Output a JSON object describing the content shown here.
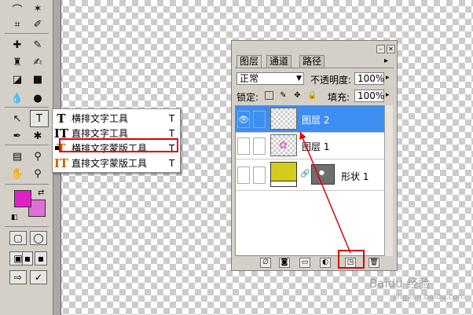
{
  "toolbox": {
    "tools": [
      "lasso-icon",
      "magic-wand-icon",
      "crop-icon",
      "slice-icon",
      "healing-brush-icon",
      "brush-icon",
      "clone-stamp-icon",
      "history-brush-icon",
      "eraser-icon",
      "gradient-icon",
      "blur-icon",
      "dodge-icon",
      "path-select-icon",
      "type-tool-icon",
      "pen-icon",
      "custom-shape-icon",
      "notes-icon",
      "eyedropper-icon",
      "hand-icon",
      "zoom-icon"
    ],
    "foreground_color": "#e020c8",
    "background_color": "#e070d8"
  },
  "flyout": {
    "items": [
      {
        "label": "横排文字工具",
        "key": "T",
        "icon": "T"
      },
      {
        "label": "直排文字工具",
        "key": "T",
        "icon": "IT"
      },
      {
        "label": "横排文字蒙版工具",
        "key": "T",
        "icon": "T"
      },
      {
        "label": "直排文字蒙版工具",
        "key": "T",
        "icon": "IT"
      }
    ]
  },
  "layers_panel": {
    "tabs": [
      "图层",
      "通道",
      "路径"
    ],
    "blend_mode": "正常",
    "opacity_label": "不透明度:",
    "opacity_value": "100%",
    "lock_label": "锁定:",
    "fill_label": "填充:",
    "fill_value": "100%",
    "layers": [
      {
        "name": "图层 2",
        "selected": true
      },
      {
        "name": "图层 1",
        "selected": false
      },
      {
        "name": "形状 1",
        "selected": false
      }
    ],
    "highlight_color": "#e00000",
    "selection_color": "#3d8ef0",
    "shape_color": "#d4cc1a"
  },
  "watermark": {
    "text": "Baidu 经验",
    "url": "jingyan.baidu.com"
  }
}
